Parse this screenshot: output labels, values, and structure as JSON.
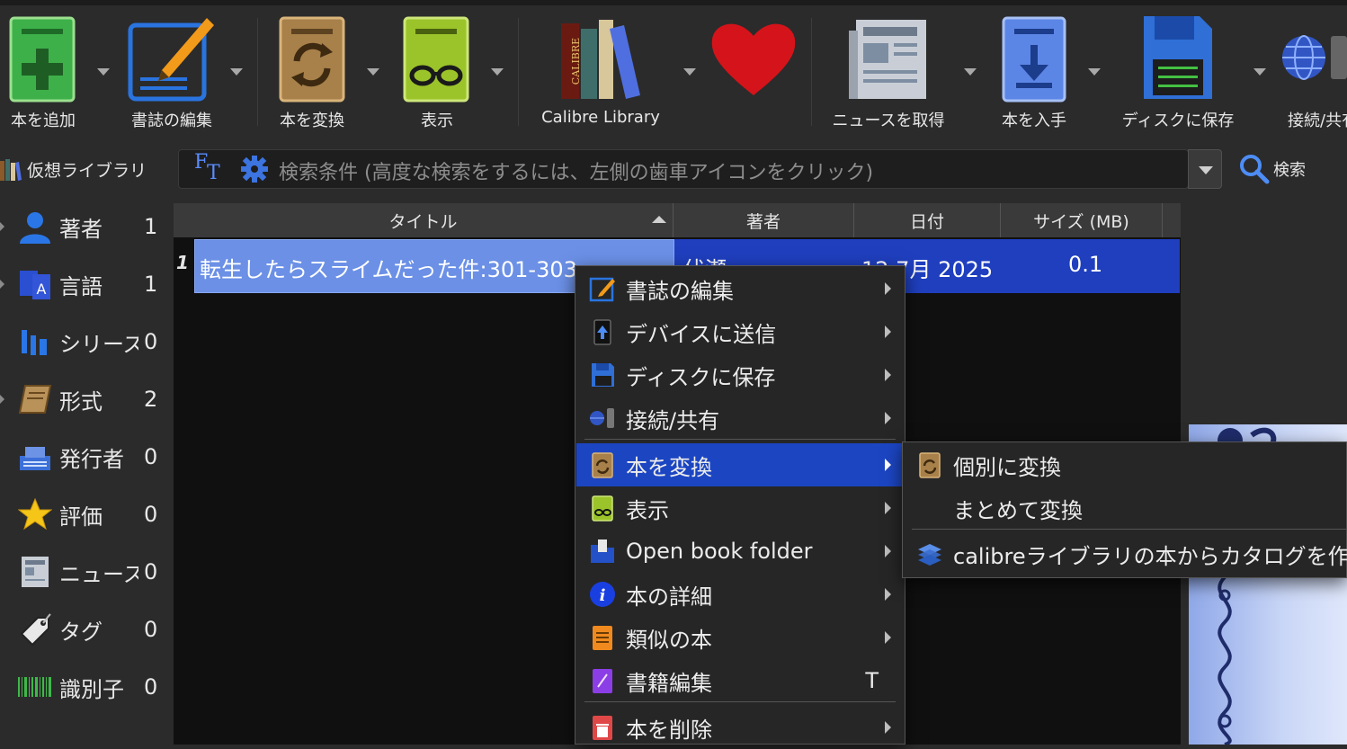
{
  "toolbar": {
    "add_book": "本を追加",
    "edit_metadata": "書誌の編集",
    "convert_books": "本を変換",
    "view": "表示",
    "library": "Calibre Library",
    "fetch_news": "ニュースを取得",
    "get_books": "本を入手",
    "save_to_disk": "ディスクに保存",
    "connect_share": "接続/共有"
  },
  "search": {
    "virtual_library": "仮想ライブラリ",
    "placeholder": "検索条件 (高度な検索をするには、左側の歯車アイコンをクリック)",
    "search_button": "検索"
  },
  "tag_browser": [
    {
      "name": "著者",
      "count": "1",
      "icon": "person-icon"
    },
    {
      "name": "言語",
      "count": "1",
      "icon": "language-icon"
    },
    {
      "name": "シリーズ",
      "count": "0",
      "icon": "series-icon"
    },
    {
      "name": "形式",
      "count": "2",
      "icon": "format-book-icon"
    },
    {
      "name": "発行者",
      "count": "0",
      "icon": "publisher-icon"
    },
    {
      "name": "評価",
      "count": "0",
      "icon": "star-icon"
    },
    {
      "name": "ニュース",
      "count": "0",
      "icon": "news-icon"
    },
    {
      "name": "タグ",
      "count": "0",
      "icon": "tag-icon"
    },
    {
      "name": "識別子",
      "count": "0",
      "icon": "barcode-icon"
    }
  ],
  "book_list": {
    "columns": [
      "タイトル",
      "著者",
      "日付",
      "サイズ (MB)"
    ],
    "rows": [
      {
        "num": "1",
        "title": "転生したらスライムだった件:301-303",
        "author": "伏瀬",
        "date": "12 7月 2025",
        "size": "0.1"
      }
    ]
  },
  "context_menu": {
    "items": [
      {
        "label": "書誌の編集",
        "icon": "edit-metadata-icon",
        "submenu": true
      },
      {
        "label": "デバイスに送信",
        "icon": "send-device-icon",
        "submenu": true
      },
      {
        "label": "ディスクに保存",
        "icon": "save-disk-icon",
        "submenu": true
      },
      {
        "label": "接続/共有",
        "icon": "connect-share-icon",
        "submenu": true
      },
      {
        "label": "本を変換",
        "icon": "convert-icon",
        "submenu": true,
        "active": true
      },
      {
        "label": "表示",
        "icon": "view-icon",
        "submenu": true
      },
      {
        "label": "Open book folder",
        "icon": "folder-icon",
        "submenu": true
      },
      {
        "label": "本の詳細",
        "icon": "info-icon",
        "submenu": true
      },
      {
        "label": "類似の本",
        "icon": "similar-books-icon",
        "submenu": true
      },
      {
        "label": "書籍編集",
        "icon": "edit-book-icon",
        "shortcut": "T"
      },
      {
        "label": "本を削除",
        "icon": "trash-icon",
        "submenu": true
      }
    ],
    "submenu": [
      {
        "label": "個別に変換",
        "icon": "convert-icon"
      },
      {
        "label": "まとめて変換",
        "icon": ""
      },
      {
        "label": "calibreライブラリの本からカタログを作成",
        "icon": "catalog-icon"
      }
    ]
  }
}
